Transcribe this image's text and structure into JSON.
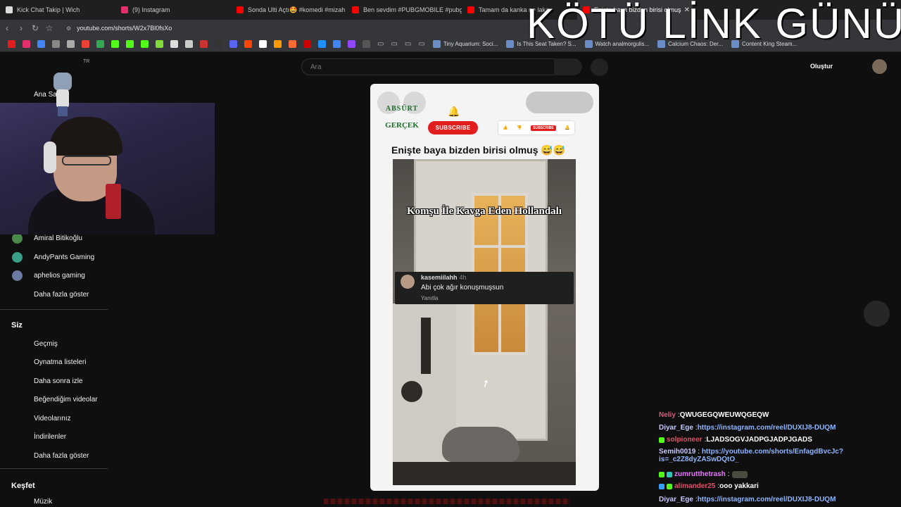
{
  "browser": {
    "tabs": [
      {
        "label": "Kick Chat Takip | Wich",
        "icon_color": "#dddddd",
        "active": false
      },
      {
        "label": "(9) Instagram",
        "icon_color": "#e1306c",
        "active": false
      },
      {
        "label": "Sonda Ulti Açtı🤩 #komedi #mizah #",
        "icon_color": "#ff0000",
        "active": false
      },
      {
        "label": "Ben sevdim #PUBGMOBILE #pubgm",
        "icon_color": "#ff0000",
        "active": false
      },
      {
        "label": "Tamam da kanka ne laka",
        "icon_color": "#ff0000",
        "active": false
      },
      {
        "label": "Enişte baya bizden birisi olmuş",
        "icon_color": "#ff0000",
        "active": true
      }
    ],
    "tab_close": "✕",
    "url": "youtube.com/shorts/W2x7Bl0fsXo",
    "bookmark_links": [
      "Tiny Aquarium: Soci...",
      "Is This Seat Taken? S...",
      "Watch analmorgulis...",
      "Calcium Chaos: Der...",
      "Content King Steam..."
    ]
  },
  "overlay_title": "KÖTÜ LİNK GÜNÜ",
  "youtube": {
    "search_placeholder": "Ara",
    "create_label": "Oluştur",
    "country": "TR",
    "sidebar": {
      "home": "Ana Sayfa",
      "subscriptions": [
        {
          "name": "Amiral Bitikoğlu",
          "color": "#4a8a4a"
        },
        {
          "name": "AndyPants Gaming",
          "color": "#3aa08a"
        },
        {
          "name": "aphelios gaming",
          "color": "#6a7aa0"
        }
      ],
      "show_more_1": "Daha fazla göster",
      "you_header": "Siz",
      "you_items": [
        "Geçmiş",
        "Oynatma listeleri",
        "Daha sonra izle",
        "Beğendiğim videolar",
        "Videolarınız",
        "İndirilenler"
      ],
      "show_more_2": "Daha fazla göster",
      "explore_header": "Keşfet",
      "explore_items": [
        "Müzik"
      ]
    },
    "short": {
      "logo_top": "ABSÜRT",
      "logo_bottom": "GERÇEK",
      "subscribe": "SUBSCRIBE",
      "mini_subscribe": "SUBSCRIBE",
      "title": "Enişte baya bizden birisi olmuş 😅😅",
      "video_caption": "Komşu İle Kavga Eden Hollandalı",
      "comment": {
        "user": "kasemiilahh",
        "time": "4h",
        "text": "Abi çok ağır konuşmuşsun",
        "reply": "Yanıtla"
      }
    }
  },
  "chat": [
    {
      "user": "Neliy",
      "text": "QWUGEGQWEUWQGEQW",
      "user_color": "#d06080",
      "type": "text",
      "badges": []
    },
    {
      "user": "Diyar_Ege",
      "text": "https://instagram.com/reel/DUXIJ8-DUQM",
      "user_color": "#c8c8ff",
      "type": "link",
      "badges": []
    },
    {
      "user": "solpioneer",
      "text": "LJADSOGVJADPGJADPJGADS",
      "user_color": "#e0506a",
      "type": "text",
      "badges": [
        "#53fc18"
      ]
    },
    {
      "user": "Semih0019",
      "text": "https://youtube.com/shorts/EnfagdBvcJc?is=_c2Z8dyZASwDQtO_",
      "user_color": "#c8c8ff",
      "type": "link",
      "badges": []
    },
    {
      "user": "zumrutthetrash",
      "text": "",
      "user_color": "#e878ff",
      "type": "emote",
      "badges": [
        "#53fc18",
        "#2ec4b6"
      ]
    },
    {
      "user": "alimander25",
      "text": "ooo yakkari",
      "user_color": "#e0506a",
      "type": "text",
      "badges": [
        "#3aa0ff",
        "#53fc18"
      ]
    },
    {
      "user": "Diyar_Ege",
      "text": "https://instagram.com/reel/DUXIJ8-DUQM",
      "user_color": "#c8c8ff",
      "type": "link",
      "badges": []
    }
  ]
}
